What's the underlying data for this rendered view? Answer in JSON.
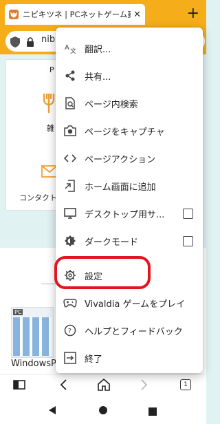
{
  "tab": {
    "favicon": "🦊",
    "title": "ニビキツネ | PCネットゲーム豪",
    "close": "✕"
  },
  "new_tab": "+",
  "address": {
    "url": "nib"
  },
  "page": {
    "cell_p": "P",
    "cell_zatsu": "雑",
    "contact": "コンタクト",
    "pc_badge": "PC",
    "windows_text": "WindowsP"
  },
  "menu": {
    "items": [
      {
        "label": "翻訳...",
        "icon": "translate-icon"
      },
      {
        "label": "共有...",
        "icon": "share-icon"
      },
      {
        "label": "ページ内検索",
        "icon": "find-in-page-icon"
      },
      {
        "label": "ページをキャプチャ",
        "icon": "camera-icon"
      },
      {
        "label": "ページアクション",
        "icon": "code-icon"
      },
      {
        "label": "ホーム画面に追加",
        "icon": "add-to-home-icon"
      },
      {
        "label": "デスクトップ用サ...",
        "icon": "desktop-icon",
        "checkbox": false
      },
      {
        "label": "ダークモード",
        "icon": "dark-mode-icon",
        "checkbox": false
      },
      {
        "label": "設定",
        "icon": "gear-icon"
      },
      {
        "label": "Vivaldia ゲームをプレイ",
        "icon": "gamepad-icon"
      },
      {
        "label": "ヘルプとフィードバック",
        "icon": "help-icon"
      },
      {
        "label": "終了",
        "icon": "exit-icon"
      }
    ]
  },
  "toolbar": {
    "tab_count": "1"
  },
  "colors": {
    "accent": "#f5ad1a",
    "highlight": "#e2141e",
    "page_bg": "#e1f2f2"
  }
}
